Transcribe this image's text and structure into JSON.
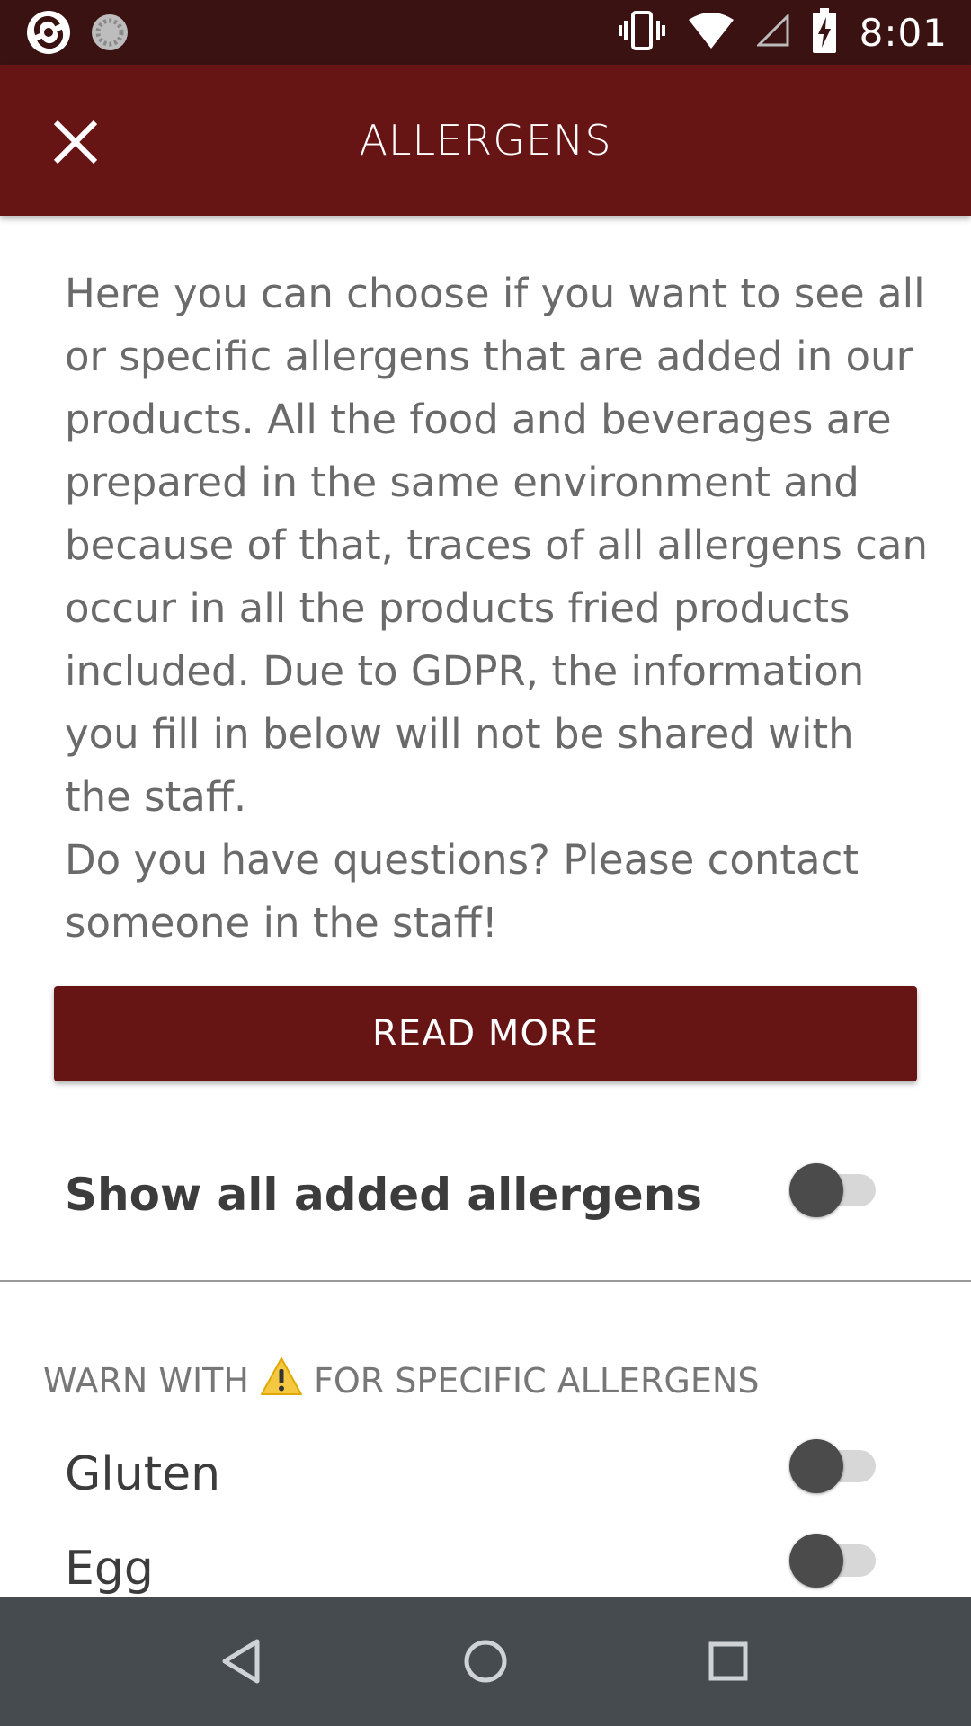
{
  "status_bar": {
    "time": "8:01",
    "left_icons": [
      "app-notification-icon",
      "sync-icon"
    ],
    "right_icons": [
      "vibrate-icon",
      "wifi-icon",
      "cellular-icon",
      "battery-charging-icon"
    ]
  },
  "app_bar": {
    "title": "ALLERGENS",
    "close_icon": "close-icon"
  },
  "intro": {
    "paragraph": "Here you can choose if you want to see all or specific allergens that are added in our products. All the food and beverages are prepared in the same environment and because of that, traces of all allergens can occur in all the products fried products included. Due to GDPR, the information you fill in below will not be shared with the staff.",
    "question": "Do you have questions? Please contact someone in the staff!"
  },
  "read_more_label": "READ MORE",
  "show_all": {
    "label": "Show all added allergens",
    "enabled": false
  },
  "warn_section": {
    "prefix": "WARN WITH",
    "icon": "warning-icon",
    "suffix": "FOR SPECIFIC ALLERGENS"
  },
  "allergens": [
    {
      "label": "Gluten",
      "enabled": false
    },
    {
      "label": "Egg",
      "enabled": false
    }
  ],
  "nav_bar": {
    "buttons": [
      "back-icon",
      "home-icon",
      "recents-icon"
    ]
  },
  "colors": {
    "status_bar": "#3a1212",
    "primary": "#661414",
    "text": "#6a6a6a",
    "nav_bar": "#464b50"
  }
}
